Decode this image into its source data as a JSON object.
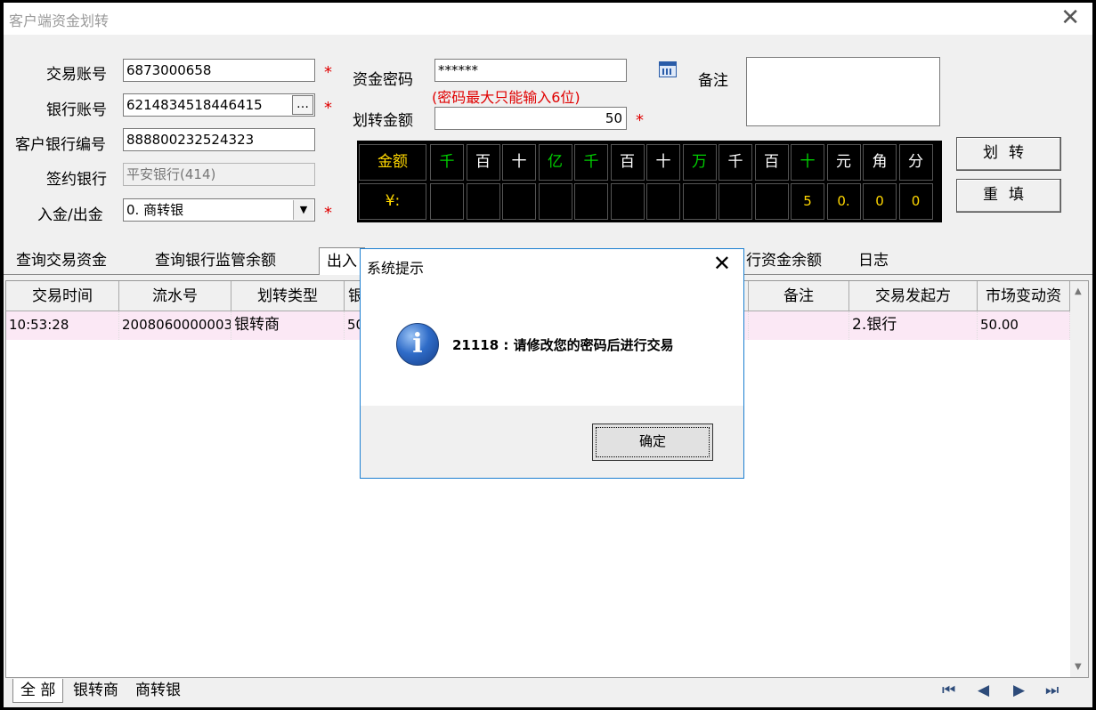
{
  "window": {
    "title": "客户端资金划转",
    "close_glyph": "✕"
  },
  "form": {
    "trade_account_label": "交易账号",
    "trade_account_value": "6873000658",
    "bank_account_label": "银行账号",
    "bank_account_value": "6214834518446415",
    "bank_account_btn": "…",
    "client_bank_no_label": "客户银行编号",
    "client_bank_no_value": "888800232524323",
    "signed_bank_label": "签约银行",
    "signed_bank_value": "平安银行(414)",
    "direction_label": "入金/出金",
    "direction_value": "0. 商转银",
    "fund_password_label": "资金密码",
    "fund_password_value": "******",
    "password_hint": "(密码最大只能输入6位)",
    "transfer_amount_label": "划转金额",
    "transfer_amount_value": "50",
    "remark_label": "备注",
    "required_mark": "*"
  },
  "buttons": {
    "transfer": "划转",
    "reset": "重填"
  },
  "amount_grid": {
    "header_label": "金额",
    "units": [
      "千",
      "百",
      "十",
      "亿",
      "千",
      "百",
      "十",
      "万",
      "千",
      "百",
      "十",
      "元",
      "角",
      "分"
    ],
    "unit_colors": [
      "#00d000",
      "#ffffff",
      "#ffffff",
      "#00d000",
      "#00d000",
      "#ffffff",
      "#ffffff",
      "#00d000",
      "#ffffff",
      "#ffffff",
      "#00d000",
      "#ffffff",
      "#ffffff",
      "#ffffff"
    ],
    "currency_label": "¥:",
    "digits": [
      "",
      "",
      "",
      "",
      "",
      "",
      "",
      "",
      "",
      "",
      "5",
      "0.",
      "0",
      "0"
    ],
    "label_color": "#ffd700",
    "digit_color": "#ffd700"
  },
  "tabs": [
    "查询交易资金",
    "查询银行监管余额",
    "出入",
    "行资金余额",
    "日志"
  ],
  "table": {
    "headers": [
      "交易时间",
      "流水号",
      "划转类型",
      "银",
      "备注",
      "交易发起方",
      "市场变动资"
    ],
    "rows": [
      [
        "10:53:28",
        "2008060000003",
        "银转商",
        "50",
        "",
        "2.银行",
        "50.00"
      ]
    ]
  },
  "bottom_tabs": [
    "全 部",
    "银转商",
    "商转银"
  ],
  "pager": [
    "⏮",
    "◀",
    "▶",
    "⏭"
  ],
  "dialog": {
    "title": "系统提示",
    "close_glyph": "✕",
    "icon": "info-icon",
    "message": "21118 : 请修改您的密码后进行交易",
    "ok": "确定"
  }
}
